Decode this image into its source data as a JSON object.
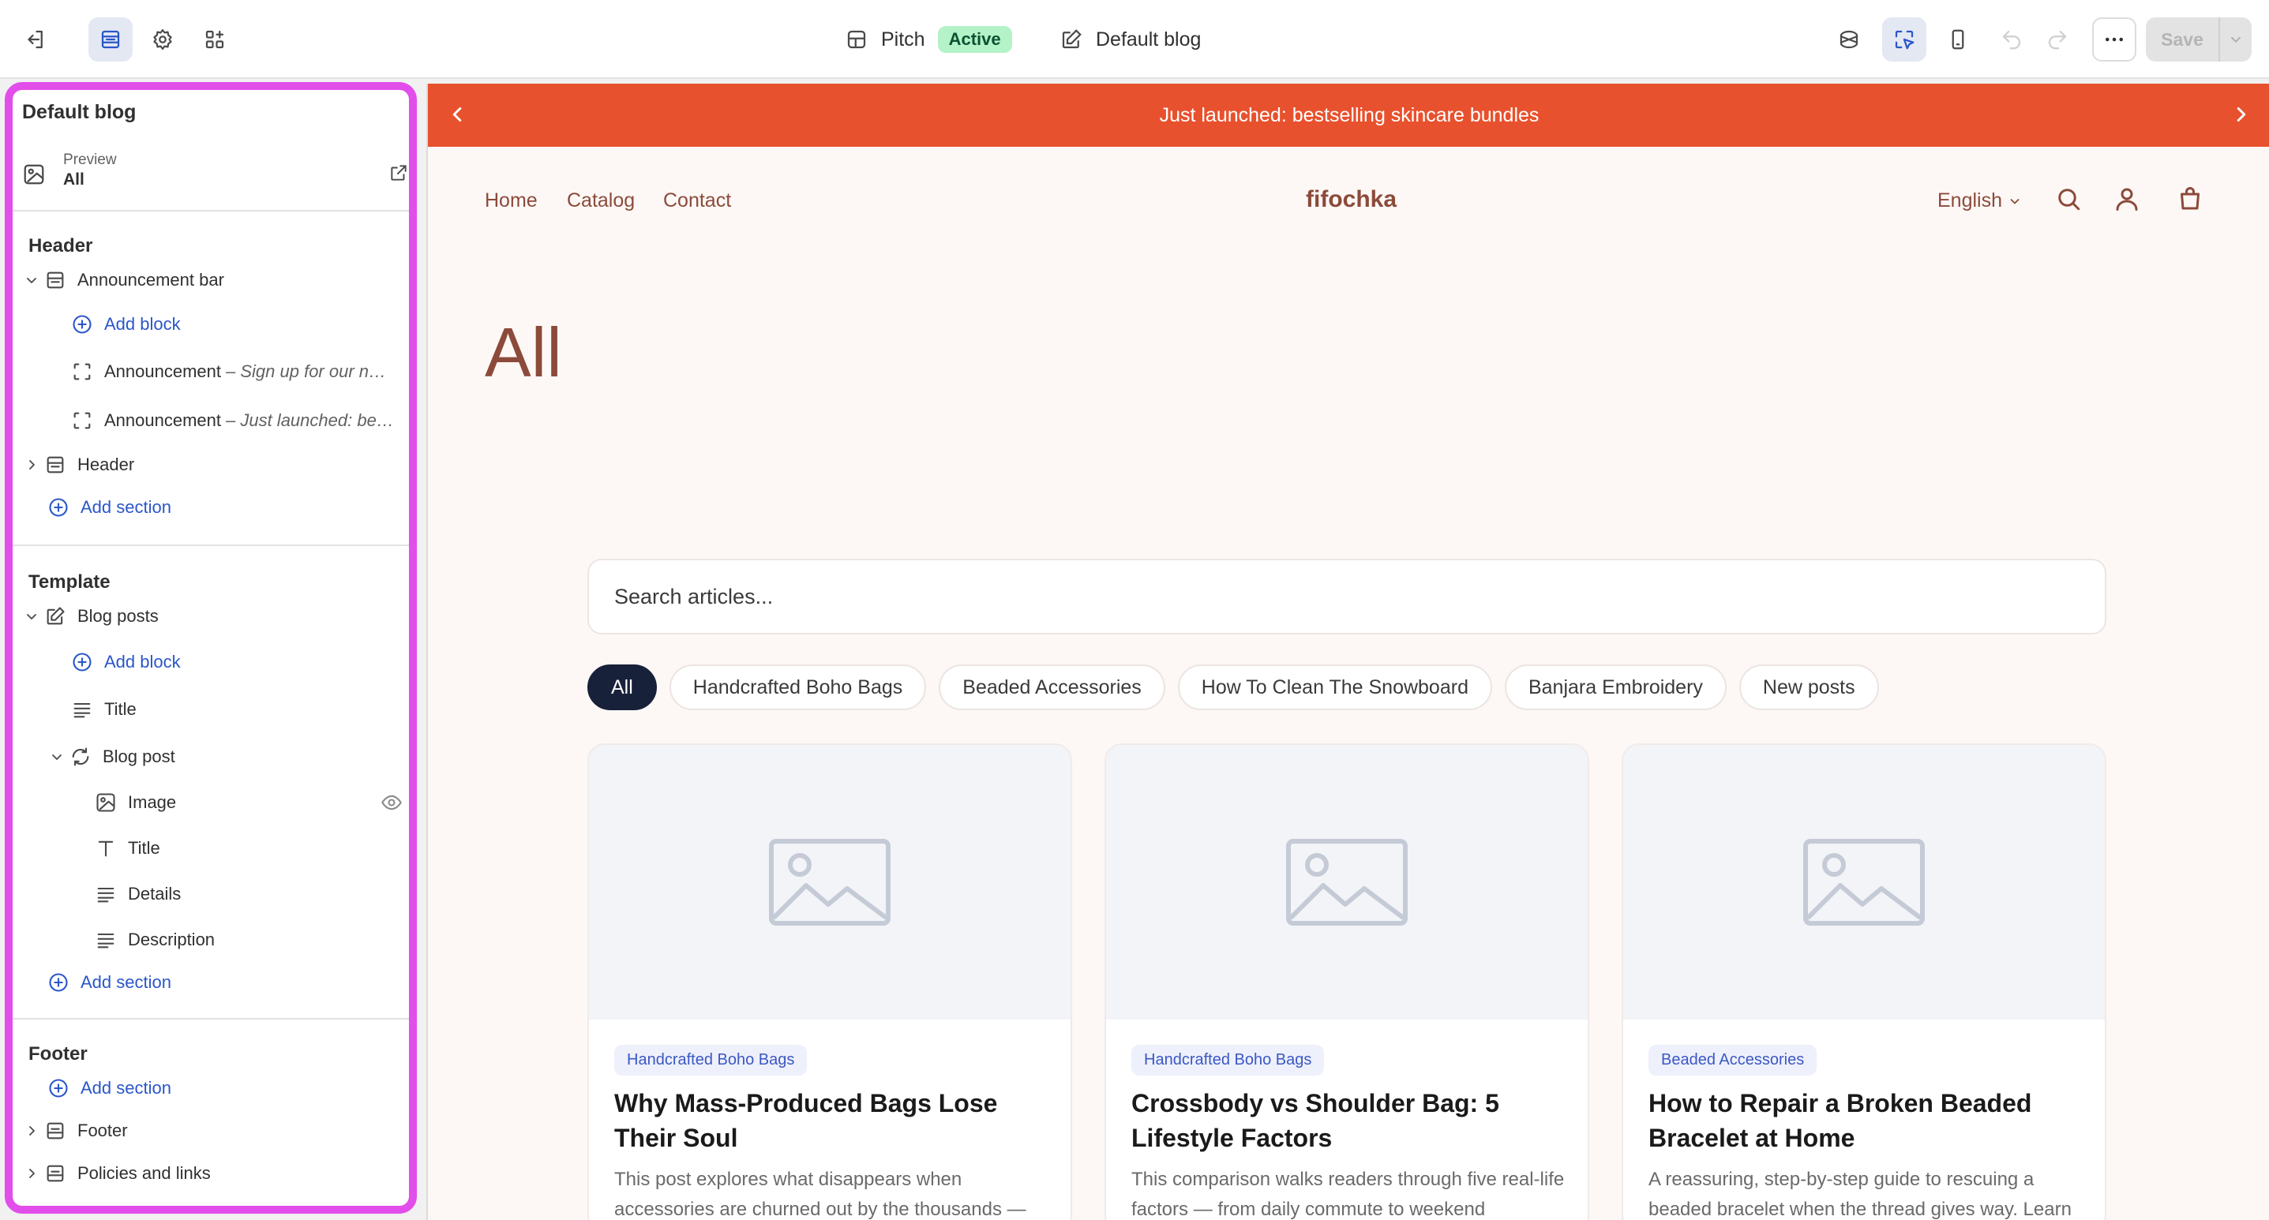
{
  "topbar": {
    "theme_name": "Pitch",
    "theme_status": "Active",
    "template_name": "Default blog",
    "save_label": "Save"
  },
  "sidebar": {
    "title": "Default blog",
    "preview": {
      "label": "Preview",
      "value": "All"
    },
    "header_section": {
      "heading": "Header",
      "announcement_bar": "Announcement bar",
      "add_block": "Add block",
      "announcement_1": {
        "name": "Announcement",
        "detail": "– Sign up for our newsletter"
      },
      "announcement_2": {
        "name": "Announcement",
        "detail": "– Just launched: bestselling skincare bundles"
      },
      "header": "Header",
      "add_section": "Add section"
    },
    "template_section": {
      "heading": "Template",
      "blog_posts": "Blog posts",
      "add_block": "Add block",
      "title": "Title",
      "blog_post": "Blog post",
      "image": "Image",
      "post_title": "Title",
      "details": "Details",
      "description": "Description",
      "add_section": "Add section"
    },
    "footer_section": {
      "heading": "Footer",
      "add_section": "Add section",
      "footer": "Footer",
      "policies": "Policies and links"
    }
  },
  "store": {
    "announcement": "Just launched: bestselling skincare bundles",
    "nav": [
      "Home",
      "Catalog",
      "Contact"
    ],
    "logo": "fifochka",
    "language": "English",
    "page_title": "All",
    "search_placeholder": "Search articles...",
    "filters": [
      "All",
      "Handcrafted Boho Bags",
      "Beaded Accessories",
      "How To Clean The Snowboard",
      "Banjara Embroidery",
      "New posts"
    ],
    "articles": [
      {
        "tag": "Handcrafted Boho Bags",
        "title": "Why Mass-Produced Bags Lose Their Soul",
        "description": "This post explores what disappears when accessories are churned out by the thousands —"
      },
      {
        "tag": "Handcrafted Boho Bags",
        "title": "Crossbody vs Shoulder Bag: 5 Lifestyle Factors",
        "description": "This comparison walks readers through five real-life factors — from daily commute to weekend"
      },
      {
        "tag": "Beaded Accessories",
        "title": "How to Repair a Broken Beaded Bracelet at Home",
        "description": "A reassuring, step-by-step guide to rescuing a beaded bracelet when the thread gives way. Learn"
      }
    ]
  },
  "colors": {
    "sidebar_highlight": "#e24ee9",
    "announcement_bg": "#e8512d",
    "store_text": "#8c4a3a",
    "link_blue": "#2a56c9",
    "active_badge": "#b4f2c8"
  }
}
